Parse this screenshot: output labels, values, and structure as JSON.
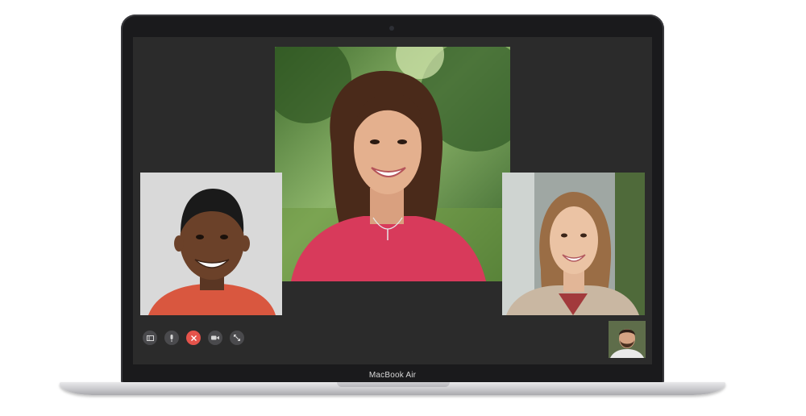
{
  "device": {
    "label": "MacBook Air"
  },
  "participants": [
    {
      "id": "main"
    },
    {
      "id": "left"
    },
    {
      "id": "right"
    },
    {
      "id": "self"
    }
  ],
  "controls": {
    "sidebar_icon": "sidebar-icon",
    "mute_icon": "microphone-icon",
    "end_icon": "close-icon",
    "camera_icon": "video-camera-icon",
    "fullscreen_icon": "expand-icon",
    "end_color": "#e5534b"
  }
}
